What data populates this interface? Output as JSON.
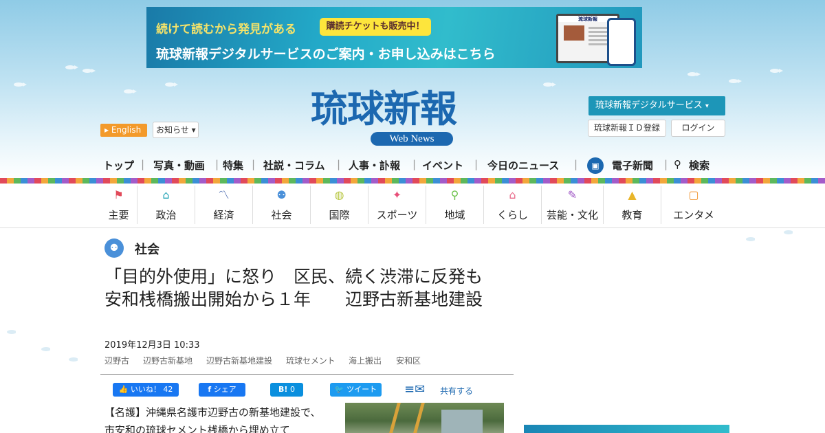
{
  "banner": {
    "line1": "続けて読むから発見がある",
    "pill": "購読チケットも販売中！",
    "line2": "琉球新報デジタルサービスのご案内・お申し込みはこちら",
    "device_title": "琉球新報"
  },
  "header": {
    "logo": "琉球新報",
    "logo_sub": "Web News",
    "english": "English",
    "notice": "お知らせ",
    "digital_service": "琉球新報デジタルサービス",
    "id_register": "琉球新報ＩＤ登録",
    "login": "ログイン"
  },
  "topnav": {
    "items": [
      "トップ",
      "写真・動画",
      "特集",
      "社説・コラム",
      "人事・訃報",
      "イベント",
      "今日のニュース"
    ],
    "e_paper": "電子新聞",
    "search": "検索"
  },
  "categories": [
    {
      "label": "主要",
      "icon": "flag-icon",
      "color": "#e14a5a",
      "glyph": "⚑"
    },
    {
      "label": "政治",
      "icon": "building-icon",
      "color": "#2aa6b8",
      "glyph": "⌂"
    },
    {
      "label": "経済",
      "icon": "chart-icon",
      "color": "#3b5ea8",
      "glyph": "〽"
    },
    {
      "label": "社会",
      "icon": "people-icon",
      "color": "#4a90d9",
      "glyph": "👥"
    },
    {
      "label": "国際",
      "icon": "globe-icon",
      "color": "#b5c43a",
      "glyph": "◍"
    },
    {
      "label": "スポーツ",
      "icon": "runner-icon",
      "color": "#e8507a",
      "glyph": "✦"
    },
    {
      "label": "地域",
      "icon": "pin-icon",
      "color": "#6cc24a",
      "glyph": "⚲"
    },
    {
      "label": "くらし",
      "icon": "house-icon",
      "color": "#e86a8a",
      "glyph": "⌂"
    },
    {
      "label": "芸能・文化",
      "icon": "brush-icon",
      "color": "#9b4fc2",
      "glyph": "✎"
    },
    {
      "label": "教育",
      "icon": "graduation-cap-icon",
      "color": "#e8b52a",
      "glyph": "▲"
    },
    {
      "label": "エンタメ",
      "icon": "tv-icon",
      "color": "#f0922b",
      "glyph": "▢"
    }
  ],
  "article": {
    "section": "社会",
    "title": "「目的外使用」に怒り　区民、続く渋滞に反発も　安和桟橋搬出開始から１年　　辺野古新基地建設",
    "date": "2019年12月3日 10:33",
    "tags": [
      "辺野古",
      "辺野古新基地",
      "辺野古新基地建設",
      "琉球セメント",
      "海上搬出",
      "安和区"
    ],
    "lead": "【名護】沖縄県名護市辺野古の新基地建設で、市安和の琉球セメント桟橋から埋め立て"
  },
  "share": {
    "like": "いいね！",
    "like_count": "42",
    "fb_share": "シェア",
    "hatena": "B!",
    "hatena_count": "0",
    "tweet": "ツイート",
    "share_label": "共有する"
  }
}
